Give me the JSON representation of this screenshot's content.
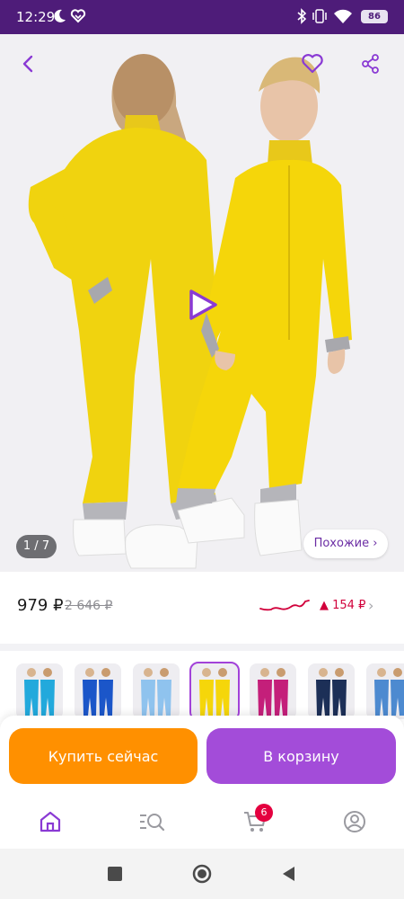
{
  "status_bar": {
    "time": "12:29",
    "battery": "86",
    "icons": [
      "moon-icon",
      "heart-app-icon",
      "bluetooth-icon",
      "wifi-icon",
      "battery-icon"
    ]
  },
  "hero": {
    "counter": "1 / 7",
    "similar_label": "Похожие ›",
    "icons": [
      "back-arrow-icon",
      "heart-outline-icon",
      "share-icon",
      "play-icon"
    ]
  },
  "price": {
    "current": "979 ₽",
    "old": "2 646 ₽",
    "delta": "▲ 154 ₽"
  },
  "variants": {
    "count": 7,
    "selected_index": 3,
    "colors": [
      "#22a9dc",
      "#1b56c9",
      "#8fc3ee",
      "#f5d60a",
      "#c41f7a",
      "#1c2f57",
      "#4d8ad0"
    ]
  },
  "actions": {
    "buy_now": "Купить сейчас",
    "add_to_cart": "В корзину"
  },
  "bottom_nav": {
    "cart_badge": "6",
    "items": [
      "home-icon",
      "catalog-search-icon",
      "cart-icon",
      "profile-icon"
    ]
  },
  "colors": {
    "status_bar": "#4e1c79",
    "accent": "#a34cd9",
    "buy_button": "#ff9000",
    "product_yellow": "#f5d60a",
    "price_delta": "#d1003b"
  }
}
